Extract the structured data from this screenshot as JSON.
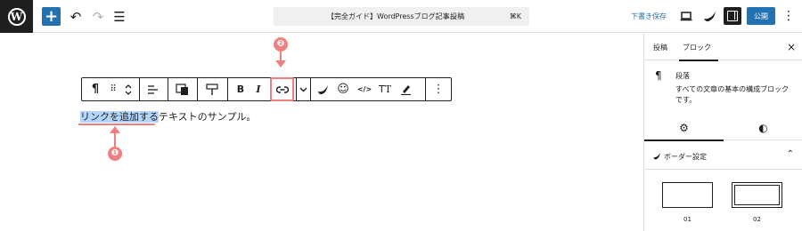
{
  "topbar": {
    "logo_letter": "W",
    "inserter_label": "+",
    "undo_glyph": "↶",
    "redo_glyph": "↷",
    "listview_glyph": "☰",
    "command_title": "【完全ガイド】WordPressブログ記事...",
    "command_type": "· 投稿",
    "command_shortcut": "⌘K",
    "save_draft_label": "下書き保存",
    "publish_label": "公開",
    "options_glyph": "⋮"
  },
  "toolbar": {
    "paragraph_glyph": "¶",
    "drag_glyph": "⠿",
    "move_glyph": "⌃",
    "align_glyph": "☰",
    "bold_label": "B",
    "italic_label": "I",
    "link_glyph": "⊖",
    "more_glyph": "⌄",
    "emoji_glyph": "☺",
    "code_glyph": "</>",
    "text_glyph": "ꓔT",
    "options_glyph": "⋮"
  },
  "editor": {
    "selected_text": "リンクを追加する",
    "rest_text": "テキストのサンプル。"
  },
  "annotations": {
    "badge_1": "❶",
    "badge_2": "❷",
    "color": "#f08080"
  },
  "sidebar": {
    "tab_post": "投稿",
    "tab_block": "ブロック",
    "close_glyph": "×",
    "block_icon": "¶",
    "block_name": "段落",
    "block_desc": "すべての文章の基本の構成ブロックです。",
    "settings_glyph": "⚙",
    "styles_glyph": "◐",
    "panel_title": "ボーダー設定",
    "panel_chevron": "⌃",
    "options": [
      {
        "label": "01"
      },
      {
        "label": "02"
      }
    ]
  },
  "colors": {
    "accent": "#2271b1",
    "dark": "#1e1e1e",
    "selection": "#b4d5fe"
  }
}
